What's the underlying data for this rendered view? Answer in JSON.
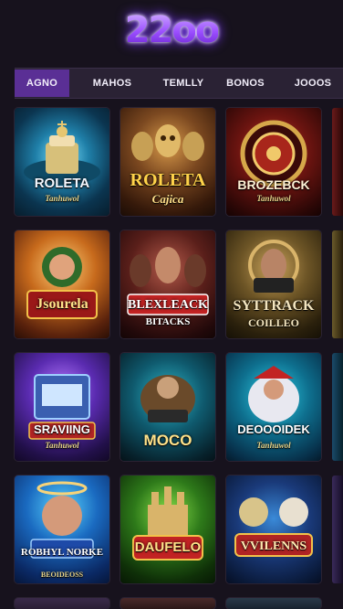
{
  "logo": {
    "text": "22oo"
  },
  "tabs": [
    {
      "label": "AGNO",
      "active": true
    },
    {
      "label": "MAHOS",
      "active": false
    },
    {
      "label": "TEMLLY",
      "active": false
    },
    {
      "label": "BONOS",
      "active": false
    },
    {
      "label": "JOOOS",
      "active": false
    }
  ],
  "games": [
    {
      "title": "ROLETA",
      "subtitle": "Tanhuwol"
    },
    {
      "title": "ROLETA",
      "subtitle": "Cajica"
    },
    {
      "title": "BROZEBCK",
      "subtitle": "Tanhuwol"
    },
    {
      "title": "Jsourela",
      "subtitle": ""
    },
    {
      "title": "BLEXLEACK",
      "subtitle": "BITACKS"
    },
    {
      "title": "SYTTRACK",
      "subtitle": "COILLEO"
    },
    {
      "title": "SRAVIING",
      "subtitle": "Tanhuwol"
    },
    {
      "title": "MOCO",
      "subtitle": ""
    },
    {
      "title": "DEOOOIDEK",
      "subtitle": "Tanhuwol"
    },
    {
      "title": "ROBHYL NORKE",
      "subtitle": "BEOIDEOSS"
    },
    {
      "title": "DAUFELO",
      "subtitle": ""
    },
    {
      "title": "VVILENNS",
      "subtitle": ""
    }
  ]
}
